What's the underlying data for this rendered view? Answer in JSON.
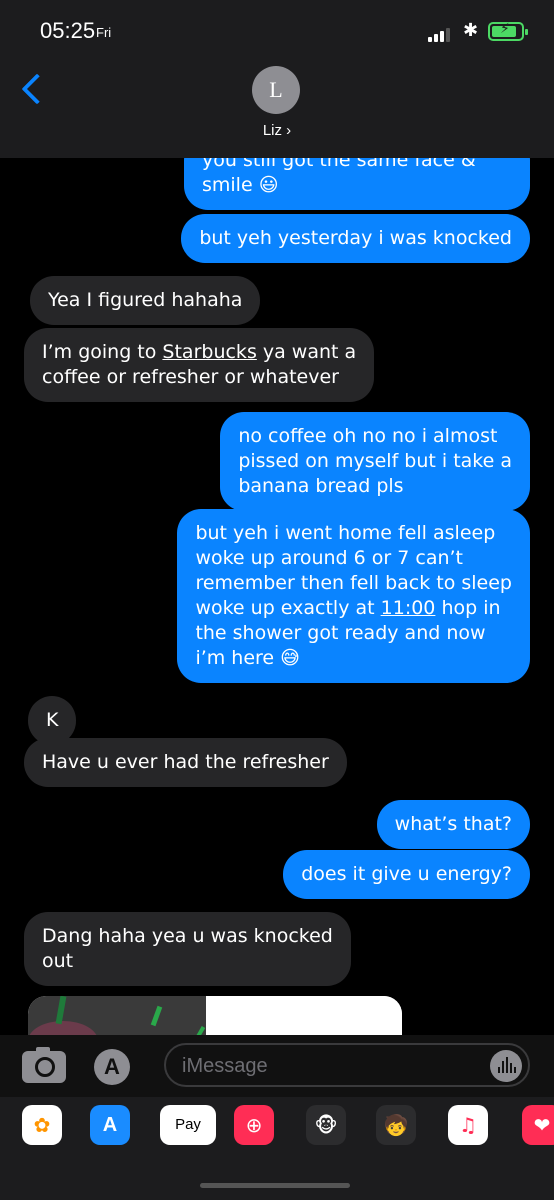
{
  "status_bar": {
    "time": "05:25",
    "day": "Fri"
  },
  "contact": {
    "initial": "L",
    "name": "Liz ›"
  },
  "messages": [
    {
      "side": "out",
      "text": "you still got the same face &\nsmile 😃"
    },
    {
      "side": "out",
      "text": "but yeh yesterday i was knocked"
    },
    {
      "side": "in",
      "text": "Yea I figured hahaha"
    },
    {
      "side": "in",
      "text_before": "I’m going to ",
      "link": "Starbucks",
      "text_after": " ya want a\ncoffee or refresher or whatever"
    },
    {
      "side": "out",
      "text": "no coffee oh no no i almost\npissed on myself but i take a\nbanana bread pls"
    },
    {
      "side": "out",
      "text_before": "but yeh i went home fell asleep\nwoke up around 6 or 7 can’t\nremember then fell back to sleep\nwoke up exactly at ",
      "link": "11:00",
      "text_after": " hop in\nthe shower got ready and now\ni’m here 😅"
    },
    {
      "side": "in",
      "text": "K"
    },
    {
      "side": "in",
      "text": "Have u ever had the refresher"
    },
    {
      "side": "out",
      "text": "what’s that?"
    },
    {
      "side": "out",
      "text": "does it give u energy?"
    },
    {
      "side": "in",
      "text": "Dang haha yea u was knocked\nout"
    }
  ],
  "input": {
    "placeholder": "iMessage",
    "value": ""
  },
  "app_drawer": {
    "apps": [
      {
        "icon": "photos-icon",
        "bg": "#ffffff",
        "glyph": "✿"
      },
      {
        "icon": "app-store-icon",
        "bg": "#1a8cff",
        "glyph": "A"
      },
      {
        "icon": "apple-pay-icon",
        "bg": "#ffffff",
        "glyph": "Pay"
      },
      {
        "icon": "web-search-icon",
        "bg": "#ff2d55",
        "glyph": "⊕"
      },
      {
        "icon": "animoji-icon",
        "bg": "#2c2c2e",
        "glyph": "🐵"
      },
      {
        "icon": "memoji-icon",
        "bg": "#2c2c2e",
        "glyph": "🧒"
      },
      {
        "icon": "music-icon",
        "bg": "#ffffff",
        "glyph": "♫"
      },
      {
        "icon": "digital-touch-icon",
        "bg": "#ff2d55",
        "glyph": "❤"
      }
    ]
  },
  "colors": {
    "outgoing": "#0a84ff",
    "incoming": "#262628",
    "background": "#000000",
    "battery": "#4cd964"
  }
}
